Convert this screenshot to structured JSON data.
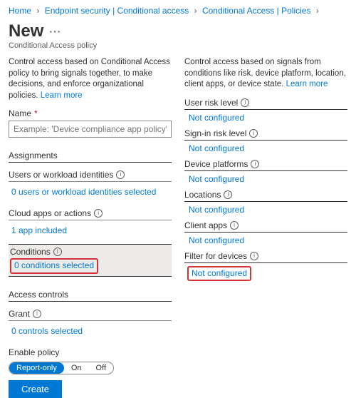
{
  "breadcrumb": {
    "home": "Home",
    "ep": "Endpoint security | Conditional access",
    "ca": "Conditional Access | Policies"
  },
  "header": {
    "title": "New",
    "subtitle": "Conditional Access policy"
  },
  "left": {
    "intro": "Control access based on Conditional Access policy to bring signals together, to make decisions, and enforce organizational policies.",
    "learn": "Learn more",
    "name_label": "Name",
    "name_placeholder": "Example: 'Device compliance app policy'",
    "assignments_title": "Assignments",
    "users_label": "Users or workload identities",
    "users_value": "0 users or workload identities selected",
    "apps_label": "Cloud apps or actions",
    "apps_value": "1 app included",
    "conditions_label": "Conditions",
    "conditions_value": "0 conditions selected",
    "access_title": "Access controls",
    "grant_label": "Grant",
    "grant_value": "0 controls selected"
  },
  "right": {
    "intro": "Control access based on signals from conditions like risk, device platform, location, client apps, or device state.",
    "learn": "Learn more",
    "user_risk": "User risk level",
    "signin_risk": "Sign-in risk level",
    "device_platforms": "Device platforms",
    "locations": "Locations",
    "client_apps": "Client apps",
    "filter_devices": "Filter for devices",
    "not_configured": "Not configured"
  },
  "footer": {
    "enable_label": "Enable policy",
    "opt_report": "Report-only",
    "opt_on": "On",
    "opt_off": "Off",
    "create": "Create"
  }
}
